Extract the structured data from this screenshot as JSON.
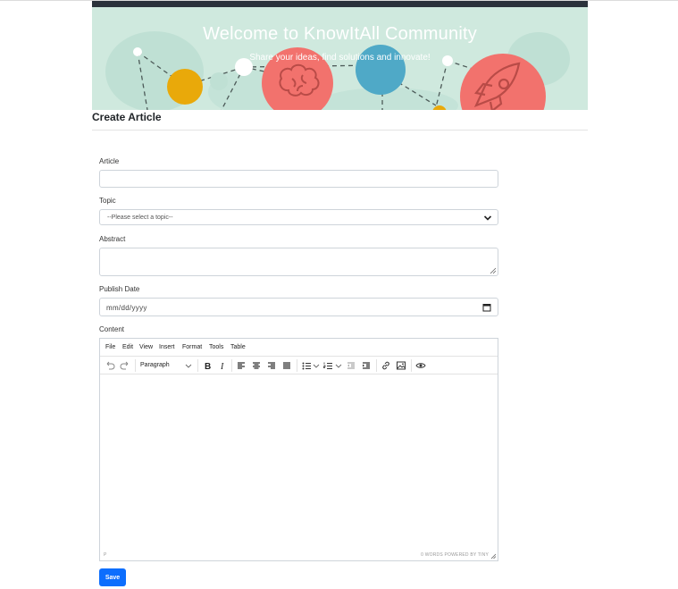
{
  "banner": {
    "title": "Welcome to KnowItAll Community",
    "subtitle": "Share your ideas, find solutions and innovate!"
  },
  "page": {
    "title": "Create Article"
  },
  "form": {
    "article_label": "Article",
    "article_value": "",
    "topic_label": "Topic",
    "topic_selected": "--Please select a topic--",
    "abstract_label": "Abstract",
    "abstract_value": "",
    "publish_date_label": "Publish Date",
    "publish_date_placeholder": "mm/dd/yyyy",
    "content_label": "Content",
    "save_label": "Save"
  },
  "editor": {
    "menu": [
      "File",
      "Edit",
      "View",
      "Insert",
      "Format",
      "Tools",
      "Table"
    ],
    "block_format": "Paragraph",
    "toolbar_icons": [
      "undo-icon",
      "redo-icon",
      "bold-icon",
      "italic-icon",
      "align-left-icon",
      "align-center-icon",
      "align-right-icon",
      "align-justify-icon",
      "bullet-list-icon",
      "numbered-list-icon",
      "outdent-icon",
      "indent-icon",
      "link-icon",
      "image-icon",
      "preview-icon"
    ],
    "status_path": "P",
    "status_right": "0 WORDS  POWERED BY TINY"
  },
  "colors": {
    "navbar": "#2b323b",
    "banner_bg": "#cfe9de",
    "primary": "#0d6efd"
  }
}
